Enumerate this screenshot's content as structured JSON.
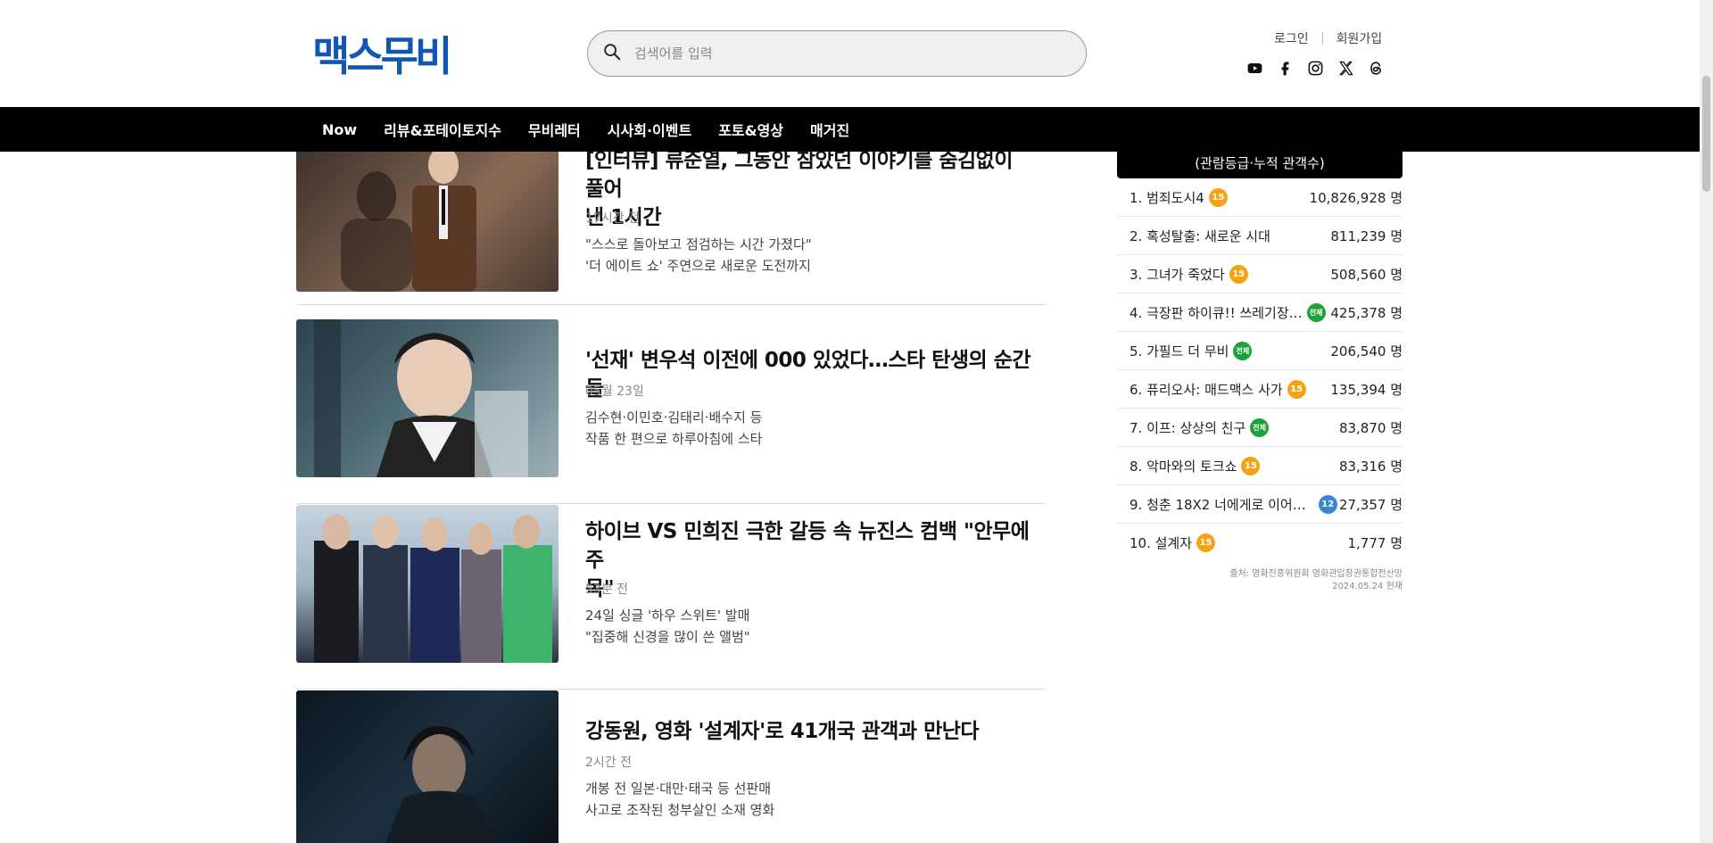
{
  "header": {
    "logo": "맥스무비",
    "search_placeholder": "검색어를 입력",
    "login": "로그인",
    "signup": "회원가입",
    "social_icons": [
      "youtube-icon",
      "facebook-icon",
      "instagram-icon",
      "x-icon",
      "threads-icon"
    ]
  },
  "nav": {
    "items": [
      "Now",
      "리뷰&포테이토지수",
      "무비레터",
      "시사회·이벤트",
      "포토&영상",
      "매거진"
    ]
  },
  "articles": [
    {
      "title_line1": "[인터뷰] 류준열, 그동안 참았던 이야기를 숨김없이 풀어",
      "title_line2": "낸 1시간",
      "time": "17시간 전",
      "desc1": "\"스스로 돌아보고 점검하는 시간 가졌다\"",
      "desc2": "'더 에이트 쇼' 주연으로 새로운 도전까지"
    },
    {
      "title_line1": "'선재' 변우석 이전에 000 있었다…스타 탄생의 순간들",
      "title_line2": "",
      "time": "05월 23일",
      "desc1": "김수현·이민호·김태리·배수지 등",
      "desc2": "작품 한 편으로 하루아침에 스타"
    },
    {
      "title_line1": "하이브 VS 민희진 극한 갈등 속 뉴진스 컴백 \"안무에 주",
      "title_line2": "목\"",
      "time": "53분 전",
      "desc1": "24일 싱글 '하우 스위트' 발매",
      "desc2": "\"집중해 신경을 많이 쓴 앨범\""
    },
    {
      "title_line1": "강동원, 영화 '설계자'로 41개국 관객과 만난다",
      "title_line2": "",
      "time": "2시간 전",
      "desc1": "개봉 전 일본·대만·태국 등 선판매",
      "desc2": "사고로 조작된 청부살인 소재 영화"
    }
  ],
  "sidebar": {
    "header": "(관람등급·누적 관객수)",
    "rankings": [
      {
        "label": "1. 범죄도시4",
        "badge": "15",
        "count": "10,826,928 명"
      },
      {
        "label": "2. 혹성탈출: 새로운 시대",
        "badge": "",
        "count": "811,239 명"
      },
      {
        "label": "3. 그녀가 죽었다",
        "badge": "15",
        "count": "508,560 명"
      },
      {
        "label": "4. 극장판 하이큐!! 쓰레기장…",
        "badge": "전체",
        "count": "425,378 명"
      },
      {
        "label": "5. 가필드 더 무비",
        "badge": "전체",
        "count": "206,540 명"
      },
      {
        "label": "6. 퓨리오사: 매드맥스 사가",
        "badge": "15",
        "count": "135,394 명"
      },
      {
        "label": "7. 이프: 상상의 친구",
        "badge": "전체",
        "count": "83,870 명"
      },
      {
        "label": "8. 악마와의 토크쇼",
        "badge": "15",
        "count": "83,316 명"
      },
      {
        "label": "9. 청춘 18X2 너에게로 이어…",
        "badge": "12",
        "count": "27,357 명"
      },
      {
        "label": "10. 설계자",
        "badge": "15",
        "count": "1,777 명"
      }
    ],
    "source1": "출처: 영화진흥위원회 영화관입장권통합전산망",
    "source2": "2024.05.24 현재"
  }
}
